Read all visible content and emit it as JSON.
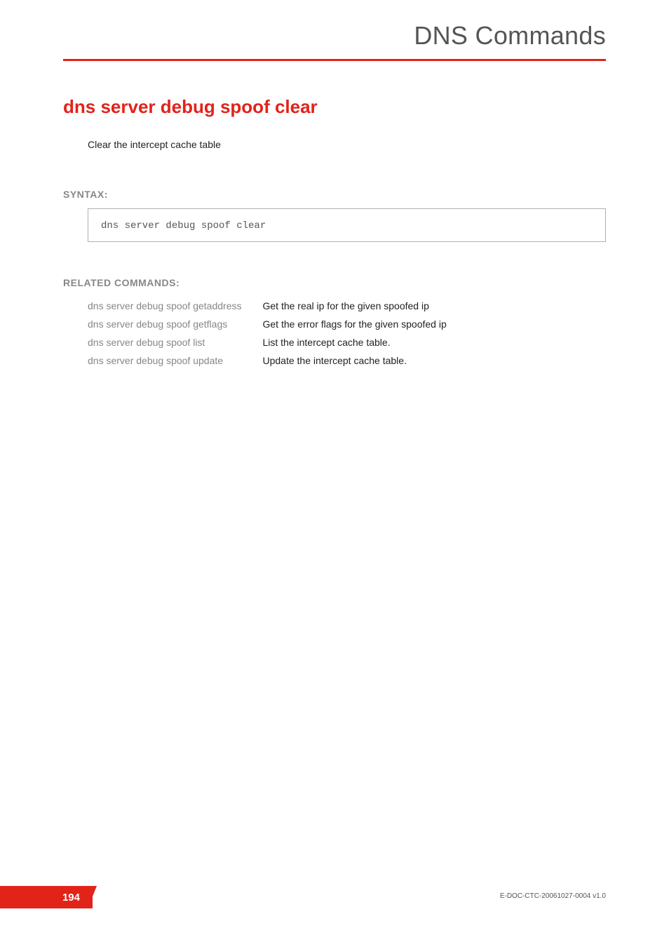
{
  "chapter": {
    "title": "DNS Commands"
  },
  "command": {
    "title": "dns server debug spoof clear",
    "description": "Clear the intercept cache table"
  },
  "syntax_label": "SYNTAX:",
  "syntax_code": "dns server debug spoof clear",
  "related_label": "RELATED COMMANDS:",
  "related": [
    {
      "cmd": "dns server debug spoof getaddress",
      "desc": "Get the real ip for the given spoofed ip"
    },
    {
      "cmd": "dns server debug spoof getflags",
      "desc": "Get the error flags for the given spoofed ip"
    },
    {
      "cmd": "dns server debug spoof list",
      "desc": "List the intercept cache table."
    },
    {
      "cmd": "dns server debug spoof update",
      "desc": "Update the intercept cache table."
    }
  ],
  "footer": {
    "doc_id": "E-DOC-CTC-20061027-0004 v1.0",
    "page_number": "194"
  }
}
